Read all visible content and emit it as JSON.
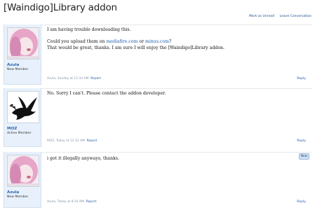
{
  "thread": {
    "title": "[Waindigo]Library addon",
    "mark_unread": "Mark as Unread",
    "leave_conversation": "Leave Conversation"
  },
  "posts": [
    {
      "username": "Azula",
      "user_title": "New Member",
      "line1": "I am having trouble downloading this.",
      "line2_pre": "Could you upload them on ",
      "link1": "mediafire.com",
      "line2_mid": " or ",
      "link2": "minus.com",
      "line2_post": "?",
      "line3": "That would be great, thanks. I am sure I will enjoy the [Waindigo]Library addon.",
      "meta": "Azula, Sunday at 11:33 AM",
      "report": "Report",
      "reply": "Reply"
    },
    {
      "username": "MOZ",
      "user_title": "Active Member",
      "line1": "No. Sorry I can't. Please contact the addon developer.",
      "meta": "MOZ, Today at 12:12 AM",
      "report": "Report",
      "reply": "Reply"
    },
    {
      "username": "Azula",
      "user_title": "New Member",
      "line1": "i got it illegally anyways, thanks.",
      "badge": "New",
      "meta": "Azula, Today at 8:10 AM",
      "report": "Report",
      "reply": "Reply"
    }
  ]
}
